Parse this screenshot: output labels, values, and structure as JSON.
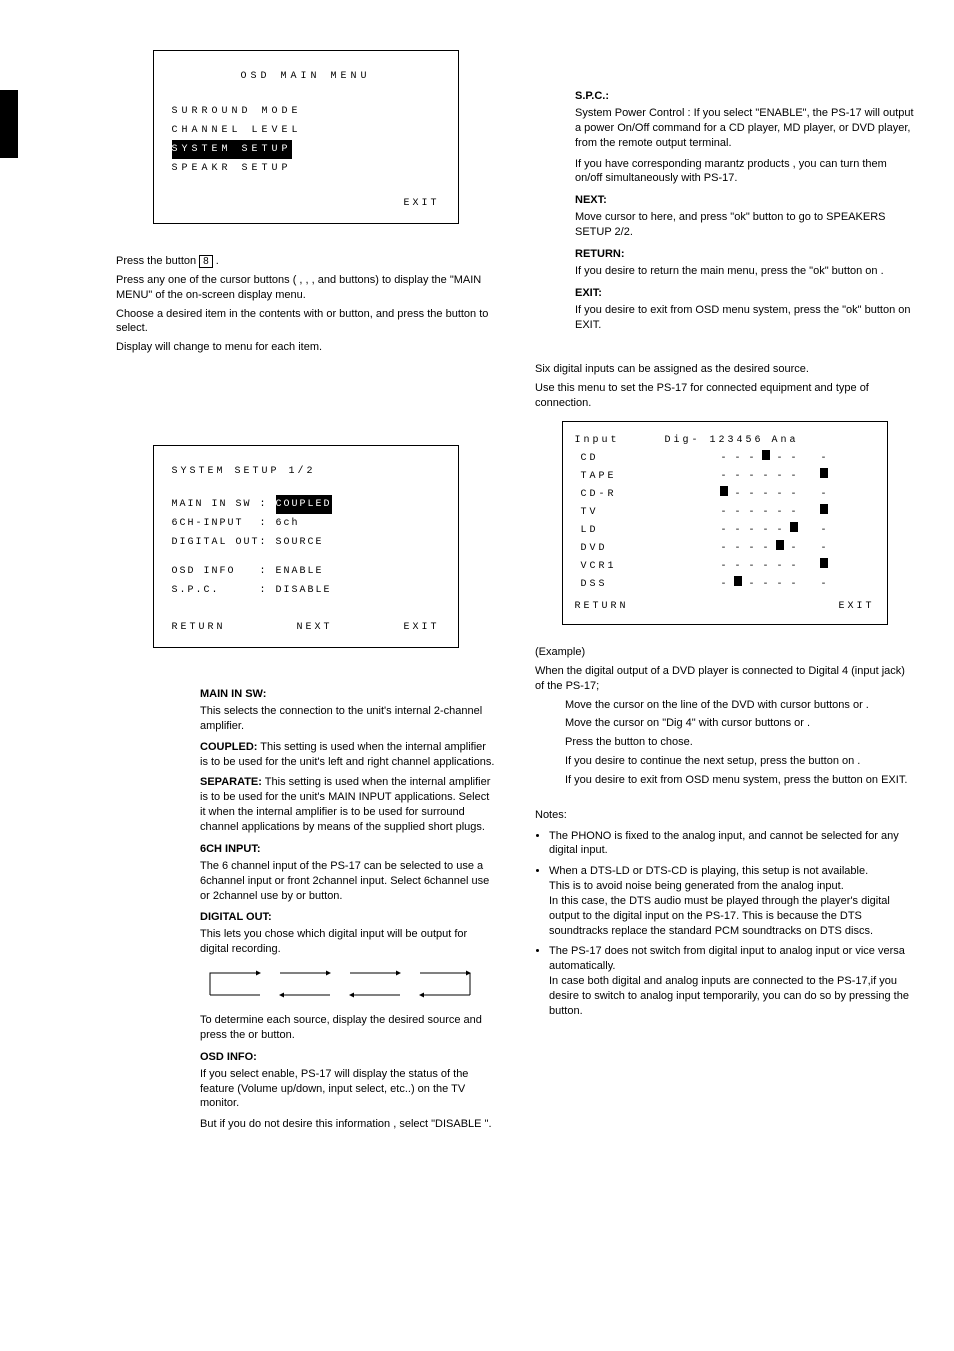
{
  "left": {
    "osd_menu": {
      "title": "OSD MAIN MENU",
      "items": [
        "SURROUND MODE",
        "CHANNEL LEVEL",
        "SYSTEM SETUP",
        "SPEAKR SETUP"
      ],
      "selected_index": 2,
      "exit": "EXIT"
    },
    "press_osd": "Press the         button ",
    "press_osd_num": "8",
    "press_osd_end": ".",
    "press_any": "Press any one of the cursor buttons (   ,   ,   , and      buttons) to display the \"MAIN MENU\" of the on-screen display menu.",
    "choose": "Choose a desired item in the contents with      or      button, and press the        button to select.",
    "display_change": "Display will change to menu for each item.",
    "system_setup_heading": "",
    "osd2": {
      "title": "SYSTEM SETUP 1/2",
      "lines": [
        {
          "k": "MAIN IN SW",
          "v": "COUPLED",
          "inv": true
        },
        {
          "k": "6CH-INPUT",
          "v": "6ch",
          "inv": false
        },
        {
          "k": "DIGITAL OUT",
          "v": "SOURCE",
          "inv": false
        }
      ],
      "lines2": [
        {
          "k": "OSD INFO",
          "v": "ENABLE"
        },
        {
          "k": "S.P.C.",
          "v": "DISABLE"
        }
      ],
      "footer": [
        "RETURN",
        "NEXT",
        "EXIT"
      ]
    },
    "defs": {
      "main_in_sw": {
        "label": "MAIN IN SW:",
        "lead": "This selects the connection to the unit's internal 2-channel amplifier.",
        "coupled_lbl": "COUPLED:",
        "coupled": " This setting is used when the internal amplifier is to be used for the unit's left and right channel applications.",
        "separate_lbl": "SEPARATE:",
        "separate": " This setting is used when the internal amplifier is to be used for the unit's MAIN INPUT applications.  Select it when the internal amplifier is to be used for surround channel applications by means of the supplied short plugs."
      },
      "sixch": {
        "label": "6CH INPUT:",
        "body": "The 6 channel input of the PS-17 can be selected to use a 6channel input or front 2channel input. Select 6channel use or 2channel use by    or    button."
      },
      "digital_out": {
        "label": "DIGITAL OUT:",
        "body": "This lets you chose which digital input will be output for digital recording.",
        "body2": "To determine each source, display the desired source and press the     or      button."
      },
      "osd_info": {
        "label": "OSD INFO:",
        "body": "If you select enable, PS-17 will display the status of the feature (Volume up/down, input select, etc..) on the TV monitor.",
        "body2": "But if you do not desire this information , select \"DISABLE \"."
      }
    }
  },
  "right": {
    "spc": {
      "label": "S.P.C.:",
      "body": "System Power Control : If you select  \"ENABLE\", the PS-17 will output a power On/Off command for a CD player, MD player, or DVD player, from the remote output terminal.",
      "body2": "If you have corresponding marantz products , you can turn them on/off simultaneously with PS-17."
    },
    "next": {
      "label": "NEXT:",
      "body": "Move cursor to here, and press \"ok\" button to go to SPEAKERS SETUP 2/2."
    },
    "return": {
      "label": "RETURN:",
      "body": "If you desire to return the main menu, press the \"ok\" button on                ."
    },
    "exit": {
      "label": "EXIT:",
      "body": "If you desire to exit from OSD menu system, press the \"ok\" button on EXIT."
    },
    "digin_heading": "",
    "digin_intro1": "Six digital inputs can be assigned as the desired source.",
    "digin_intro2": "Use this menu to set the PS-17 for connected equipment and type of connection.",
    "digmap": {
      "header_left": "Input",
      "header_dig": "Dig- 123456",
      "header_ana": "Ana",
      "rows": [
        {
          "label": "CD",
          "cells": [
            "-",
            "-",
            "-",
            "X",
            "-",
            "-"
          ],
          "ana": "-"
        },
        {
          "label": "TAPE",
          "cells": [
            "-",
            "-",
            "-",
            "-",
            "-",
            "-"
          ],
          "ana": "X"
        },
        {
          "label": "CD-R",
          "cells": [
            "X",
            "-",
            "-",
            "-",
            "-",
            "-"
          ],
          "ana": "-"
        },
        {
          "label": "TV",
          "cells": [
            "-",
            "-",
            "-",
            "-",
            "-",
            "-"
          ],
          "ana": "X"
        },
        {
          "label": "LD",
          "cells": [
            "-",
            "-",
            "-",
            "-",
            "-",
            "X"
          ],
          "ana": "-"
        },
        {
          "label": "DVD",
          "cells": [
            "-",
            "-",
            "-",
            "-",
            "X",
            "-"
          ],
          "ana": "-"
        },
        {
          "label": "VCR1",
          "cells": [
            "-",
            "-",
            "-",
            "-",
            "-",
            "-"
          ],
          "ana": "X"
        },
        {
          "label": "DSS",
          "cells": [
            "-",
            "X",
            "-",
            "-",
            "-",
            "-"
          ],
          "ana": "-"
        }
      ],
      "return": "RETURN",
      "exit": "EXIT"
    },
    "example_head": "(Example)",
    "example1": "When the digital output of a DVD player is connected to Digital 4 (input jack) of the PS-17;",
    "example_steps": [
      "Move the cursor on the line of the DVD with cursor buttons     or    .",
      "Move the cursor on \"Dig 4\" with cursor buttons      or    .",
      "Press the        button to chose.",
      "If you desire to continue the next setup, press the        button on            .",
      "If you desire to exit from OSD menu system, press the        button on EXIT."
    ],
    "notes_head": "Notes:",
    "notes": [
      "The PHONO is fixed to the analog input, and cannot be selected for any digital input.",
      "When a DTS-LD or DTS-CD is playing, this setup is not available.\nThis is to avoid noise being generated from the analog input.\nIn this case, the DTS audio must be played through the player's digital output to the digital input on the PS-17. This is because the DTS soundtracks replace the standard PCM soundtracks on DTS discs.",
      "The PS-17 does not switch from digital input to analog input or vice versa automatically.\nIn case both digital and analog inputs are connected to the PS-17,if you desire to switch to analog input temporarily, you can do so by pressing the          button."
    ]
  }
}
